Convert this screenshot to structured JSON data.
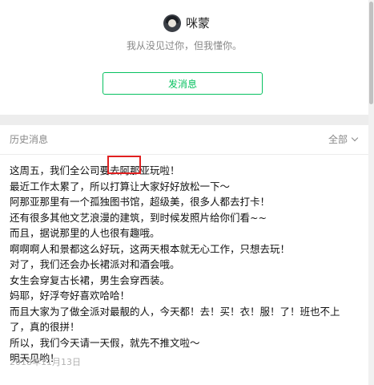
{
  "profile": {
    "name": "咪蒙",
    "signature": "我从没见过你，但我懂你。",
    "send_button": "发消息"
  },
  "history": {
    "title": "历史消息",
    "filter": "全部",
    "message_lines": [
      "这周五，我们全公司要去阿那亚玩啦！",
      "最近工作太累了，所以打算让大家好好放松一下～",
      "阿那亚那里有一个孤独图书馆，超级美，很多人都去打卡！",
      "还有很多其他文艺浪漫的建筑，到时候发照片给你们看~~",
      "而且，据说那里的人也很有趣哦。",
      "啊啊啊人和景都这么好玩，这两天根本就无心工作，只想去玩！",
      "对了，我们还会办长裙派对和酒会哦。",
      "女生会穿复古长裙，男生会穿西装。",
      "妈耶，好浮夸好喜欢哈哈！",
      "而且大家为了做全派对最靓的人，今天都！去！买！衣！服！了！班也不上了，真的很拼！",
      "所以，我们今天请一天假，就先不推文啦～",
      "明天见哟！"
    ],
    "date": "2018年11月13日"
  },
  "colors": {
    "accent": "#07c160",
    "highlight": "#e02020"
  }
}
